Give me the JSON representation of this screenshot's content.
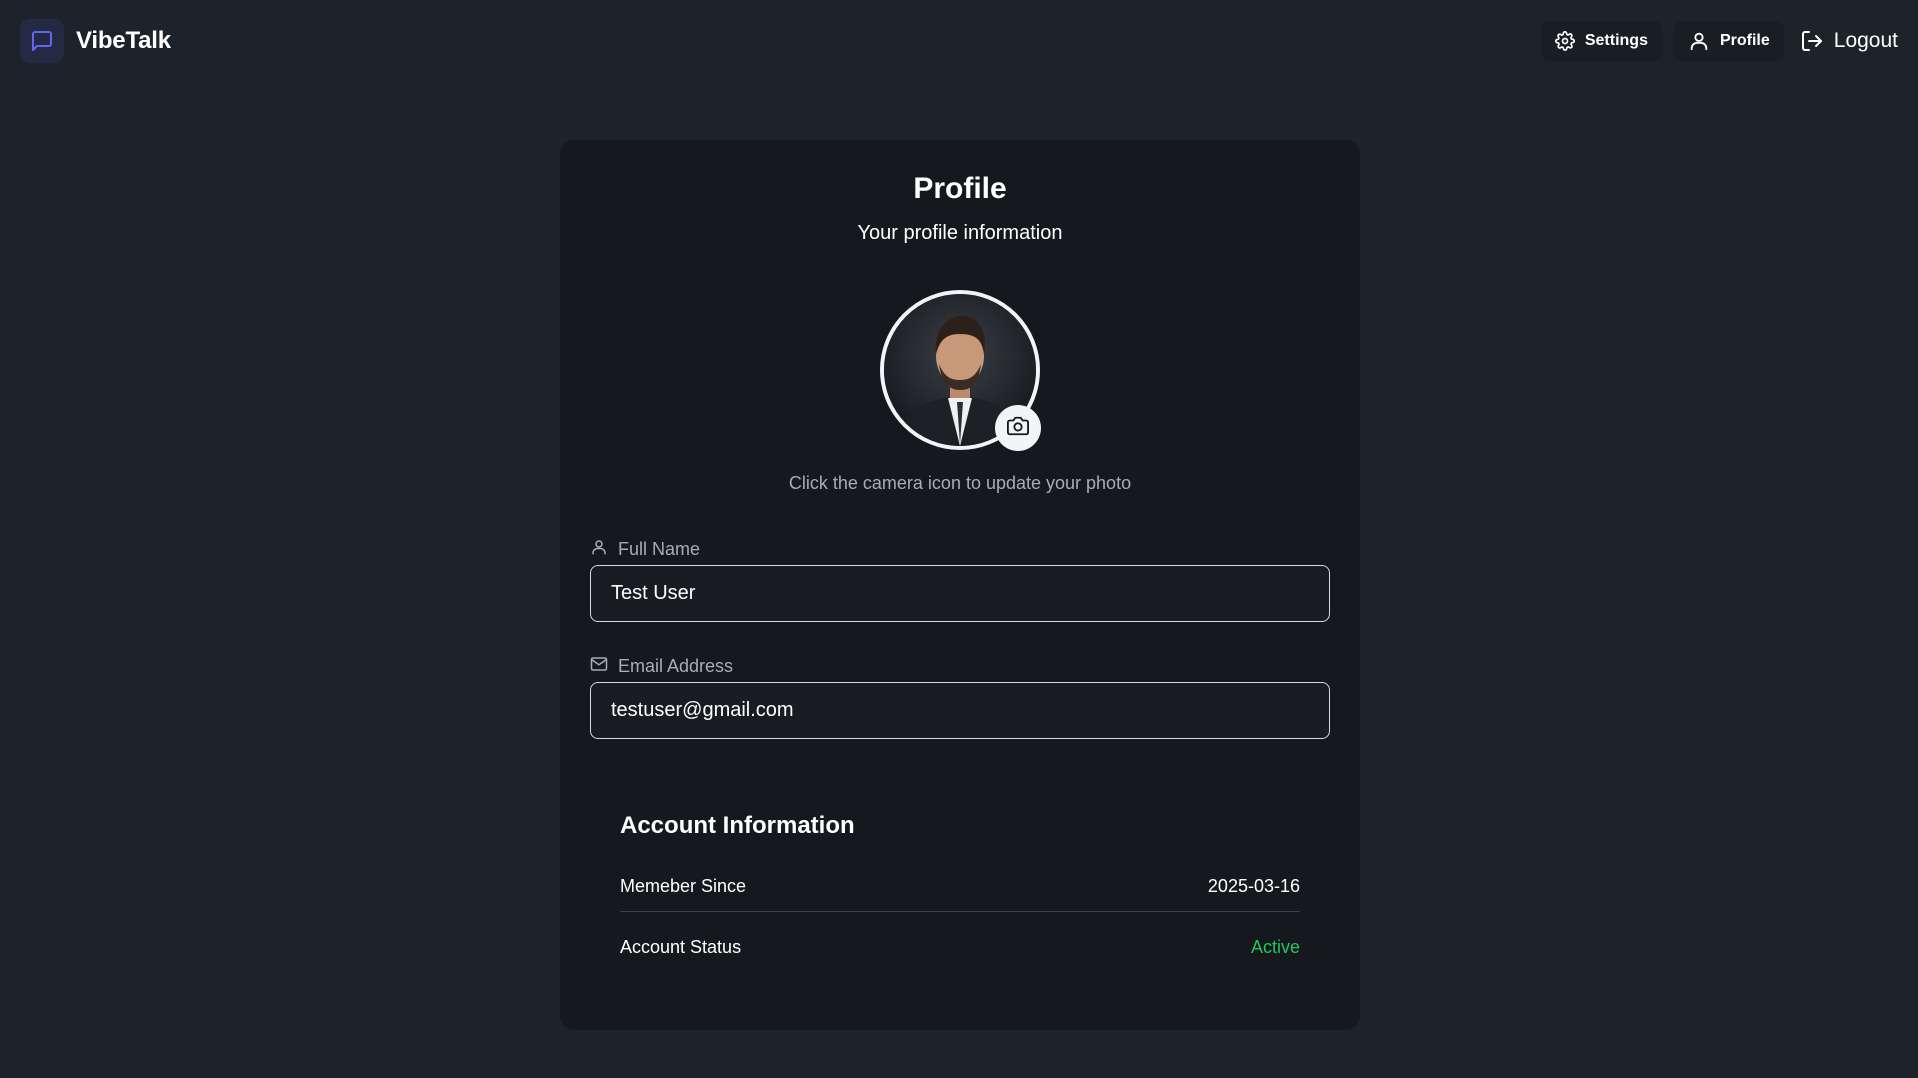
{
  "app": {
    "name": "VibeTalk"
  },
  "nav": {
    "settings_label": "Settings",
    "profile_label": "Profile",
    "logout_label": "Logout"
  },
  "profile": {
    "title": "Profile",
    "subtitle": "Your profile information",
    "photo_hint": "Click the camera icon to update your photo",
    "full_name_label": "Full Name",
    "full_name_value": "Test User",
    "email_label": "Email Address",
    "email_value": "testuser@gmail.com"
  },
  "account": {
    "title": "Account Information",
    "member_since_label": "Memeber Since",
    "member_since_value": "2025-03-16",
    "status_label": "Account Status",
    "status_value": "Active"
  },
  "colors": {
    "background": "#1d232a",
    "card": "#15191e",
    "accent": "#6366f1",
    "status_active": "#22c55e"
  },
  "icons": {
    "logo": "message-square-icon",
    "settings": "gear-icon",
    "profile": "user-icon",
    "logout": "logout-icon",
    "camera": "camera-icon",
    "full_name": "user-icon",
    "email": "mail-icon"
  }
}
